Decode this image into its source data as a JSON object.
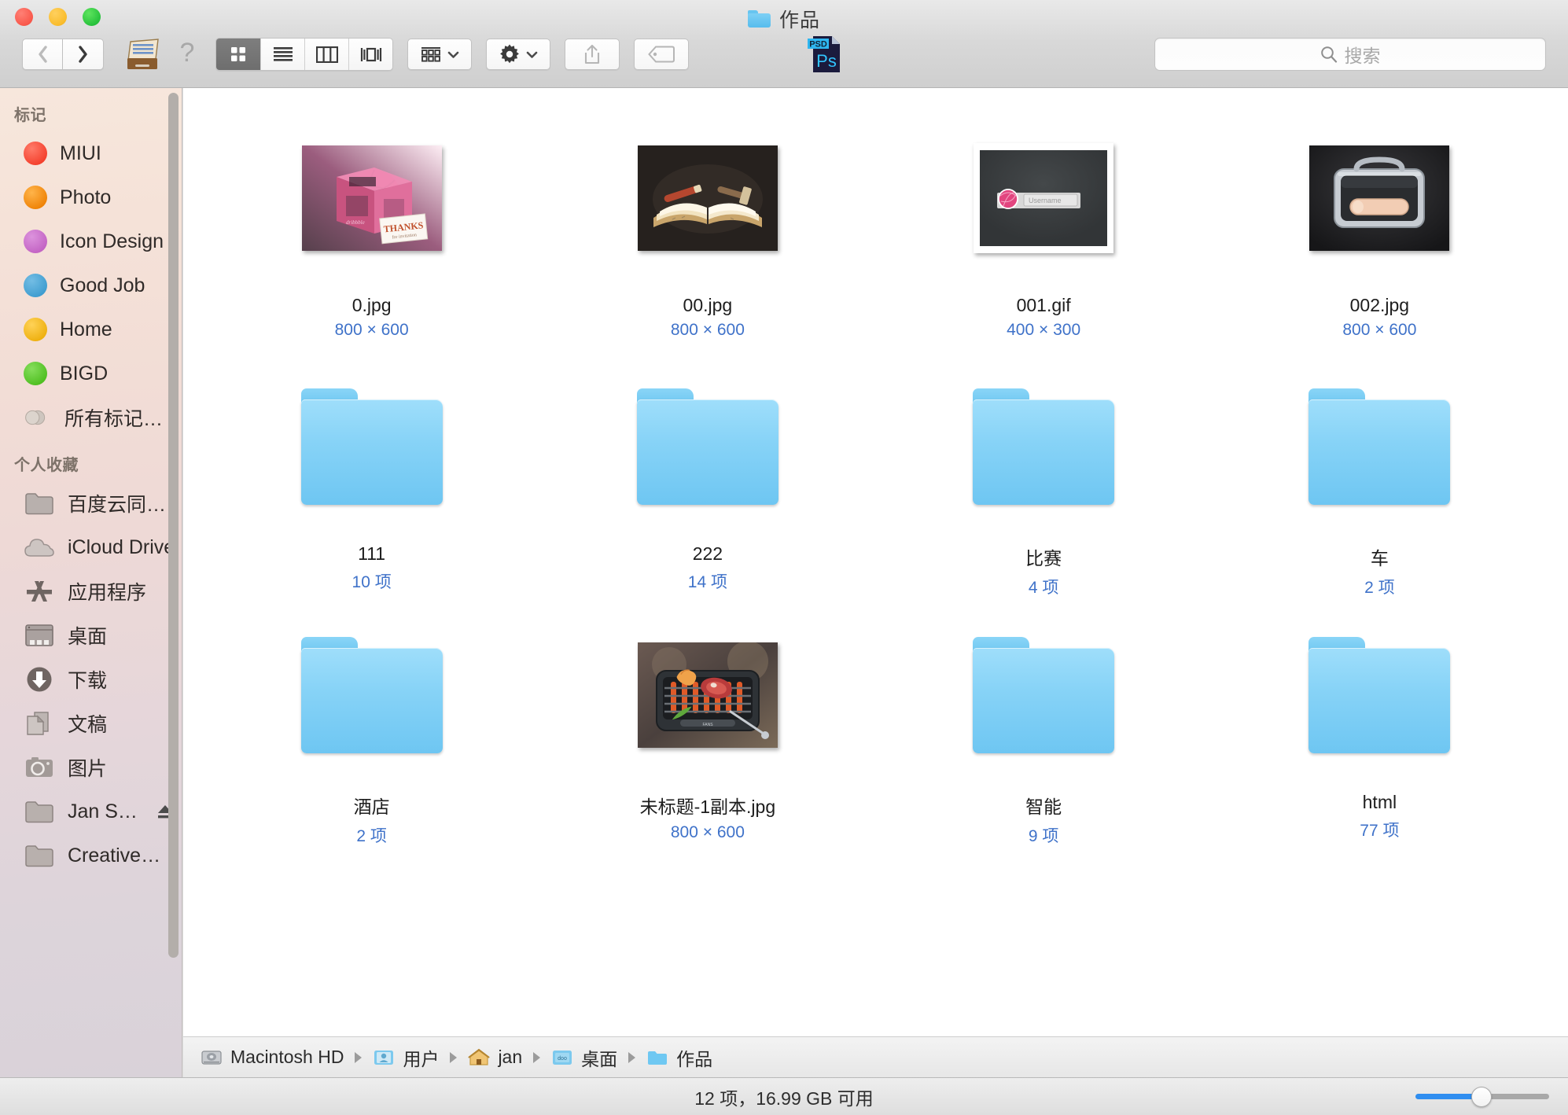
{
  "window": {
    "title": "作品",
    "title_icon": "blue-folder-icon",
    "traffic_lights": [
      "close-red",
      "minimize-yellow",
      "zoom-green"
    ]
  },
  "toolbar": {
    "back_label": "chevron-left-icon",
    "forward_label": "chevron-right-icon",
    "file_drawer_icon": "file-drawer-icon",
    "help_icon": "question-mark-icon",
    "view_modes": [
      {
        "name": "icon-view",
        "icon": "grid-icon",
        "active": true
      },
      {
        "name": "list-view",
        "icon": "list-icon",
        "active": false
      },
      {
        "name": "column-view",
        "icon": "columns-icon",
        "active": false
      },
      {
        "name": "coverflow-view",
        "icon": "coverflow-icon",
        "active": false
      }
    ],
    "arrange_icon": "arrange-grid-icon",
    "action_icon": "gear-icon",
    "share_icon": "share-upload-icon",
    "tag_icon": "tag-icon",
    "psd_icon": "photoshop-psd-file-icon",
    "psd_badge": "PSD",
    "psd_glyph": "Ps"
  },
  "search": {
    "placeholder": "搜索",
    "icon": "search-icon"
  },
  "sidebar": {
    "sections": [
      {
        "header": "标记",
        "items": [
          {
            "label": "MIUI",
            "type": "tag",
            "color": "#f4402d"
          },
          {
            "label": "Photo",
            "type": "tag",
            "color": "#ef8307"
          },
          {
            "label": "Icon Design",
            "type": "tag",
            "color": "#c364c4"
          },
          {
            "label": "Good Job",
            "type": "tag",
            "color": "#3f9dd0"
          },
          {
            "label": "Home",
            "type": "tag",
            "color": "#eeb010"
          },
          {
            "label": "BIGD",
            "type": "tag",
            "color": "#4fbf21"
          },
          {
            "label": "所有标记…",
            "type": "alltags",
            "color": "#d6cfc9"
          }
        ]
      },
      {
        "header": "个人收藏",
        "items": [
          {
            "label": "百度云同…",
            "type": "folder"
          },
          {
            "label": "iCloud Drive",
            "type": "icloud"
          },
          {
            "label": "应用程序",
            "type": "applications"
          },
          {
            "label": "桌面",
            "type": "desktop"
          },
          {
            "label": "下载",
            "type": "downloads"
          },
          {
            "label": "文稿",
            "type": "documents"
          },
          {
            "label": "图片",
            "type": "pictures"
          },
          {
            "label": "Jan S…",
            "type": "folder",
            "eject": true
          },
          {
            "label": "Creative…",
            "type": "folder"
          }
        ]
      }
    ]
  },
  "files": [
    {
      "name": "0.jpg",
      "meta": "800 × 600",
      "kind": "image",
      "art": "pink-box"
    },
    {
      "name": "00.jpg",
      "meta": "800 × 600",
      "kind": "image",
      "art": "open-book"
    },
    {
      "name": "001.gif",
      "meta": "400 × 300",
      "kind": "image",
      "art": "dribbble-login"
    },
    {
      "name": "002.jpg",
      "meta": "800 × 600",
      "kind": "image",
      "art": "metal-case"
    },
    {
      "name": "111",
      "meta": "10 项",
      "kind": "folder"
    },
    {
      "name": "222",
      "meta": "14 项",
      "kind": "folder"
    },
    {
      "name": "比赛",
      "meta": "4 项",
      "kind": "folder"
    },
    {
      "name": "车",
      "meta": "2 项",
      "kind": "folder"
    },
    {
      "name": "酒店",
      "meta": "2 项",
      "kind": "folder"
    },
    {
      "name": "未标题-1副本.jpg",
      "meta": "800 × 600",
      "kind": "image",
      "art": "grill"
    },
    {
      "name": "智能",
      "meta": "9 项",
      "kind": "folder"
    },
    {
      "name": "html",
      "meta": "77 项",
      "kind": "folder"
    }
  ],
  "pathbar": [
    {
      "label": "Macintosh HD",
      "icon": "hard-drive-icon"
    },
    {
      "label": "用户",
      "icon": "users-folder-icon"
    },
    {
      "label": "jan",
      "icon": "home-folder-icon"
    },
    {
      "label": "桌面",
      "icon": "desktop-folder-icon"
    },
    {
      "label": "作品",
      "icon": "blue-folder-icon"
    }
  ],
  "statusbar": {
    "text": "12 项，16.99 GB 可用",
    "zoom_slider": {
      "name": "icon-size-slider",
      "value": 50
    }
  }
}
